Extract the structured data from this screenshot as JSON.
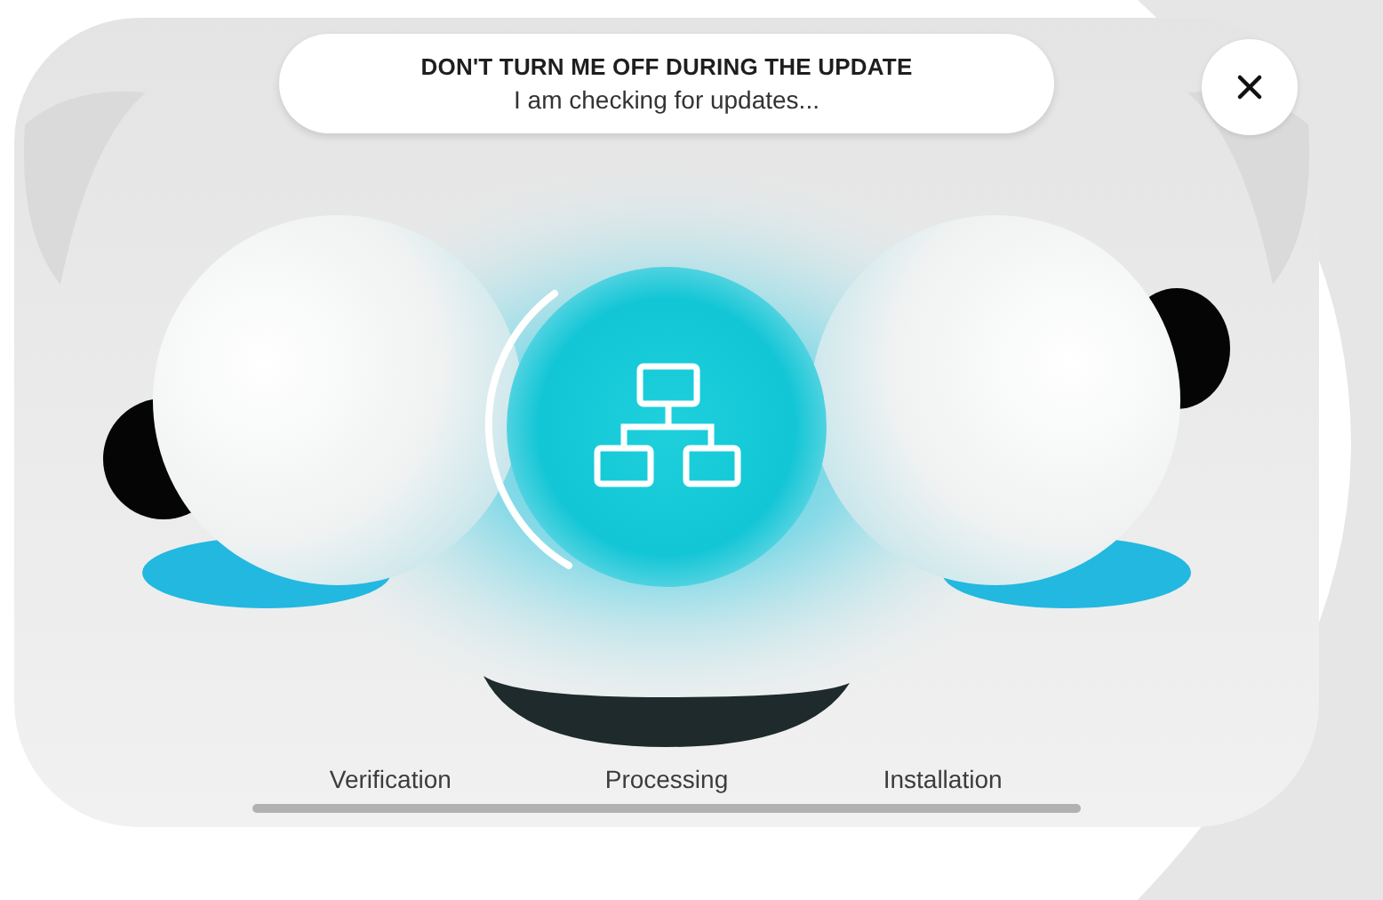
{
  "banner": {
    "title": "DON'T TURN ME OFF DURING THE UPDATE",
    "message": "I am checking for updates..."
  },
  "steps": [
    {
      "label": "Verification"
    },
    {
      "label": "Processing"
    },
    {
      "label": "Installation"
    }
  ]
}
